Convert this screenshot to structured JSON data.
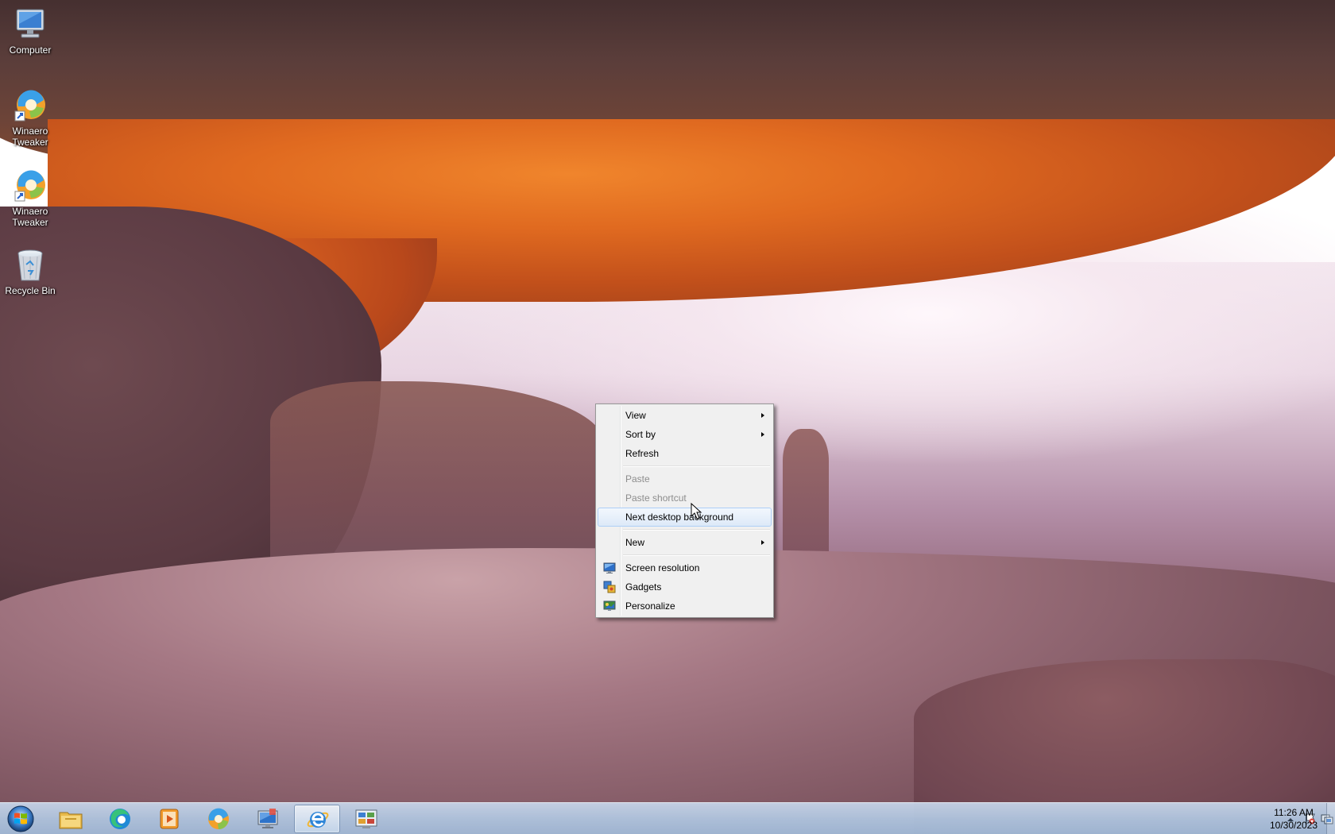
{
  "desktop_icons": [
    {
      "label": "Computer",
      "icon": "computer-icon"
    },
    {
      "label": "Winaero Tweaker",
      "icon": "winaero-tweaker-icon"
    },
    {
      "label": "Winaero Tweaker",
      "icon": "winaero-tweaker-icon"
    },
    {
      "label": "Recycle Bin",
      "icon": "recycle-bin-icon"
    }
  ],
  "context_menu": {
    "items": [
      {
        "label": "View",
        "submenu": true,
        "disabled": false
      },
      {
        "label": "Sort by",
        "submenu": true,
        "disabled": false
      },
      {
        "label": "Refresh",
        "submenu": false,
        "disabled": false
      },
      {
        "label": "Paste",
        "submenu": false,
        "disabled": true
      },
      {
        "label": "Paste shortcut",
        "submenu": false,
        "disabled": true
      },
      {
        "label": "Next desktop background",
        "submenu": false,
        "disabled": false,
        "hover": true
      },
      {
        "label": "New",
        "submenu": true,
        "disabled": false
      },
      {
        "label": "Screen resolution",
        "icon": "screen-resolution-icon"
      },
      {
        "label": "Gadgets",
        "icon": "gadgets-icon"
      },
      {
        "label": "Personalize",
        "icon": "personalize-icon"
      }
    ]
  },
  "taskbar": {
    "buttons": [
      {
        "name": "file-explorer",
        "icon": "folder-icon"
      },
      {
        "name": "edge",
        "icon": "edge-icon"
      },
      {
        "name": "media-player",
        "icon": "media-player-icon"
      },
      {
        "name": "winaero-tweaker",
        "icon": "winaero-tweaker-icon"
      },
      {
        "name": "remote-desktop",
        "icon": "remote-desktop-icon"
      },
      {
        "name": "internet-explorer",
        "icon": "internet-explorer-icon",
        "active": true
      },
      {
        "name": "control-panel",
        "icon": "control-panel-icon"
      }
    ],
    "clock": {
      "time": "11:26 AM",
      "date": "10/30/2023"
    }
  },
  "colors": {
    "menu_bg": "#f0f0f0",
    "menu_hover": "#dde9f8",
    "taskbar": "#b3c6de"
  }
}
